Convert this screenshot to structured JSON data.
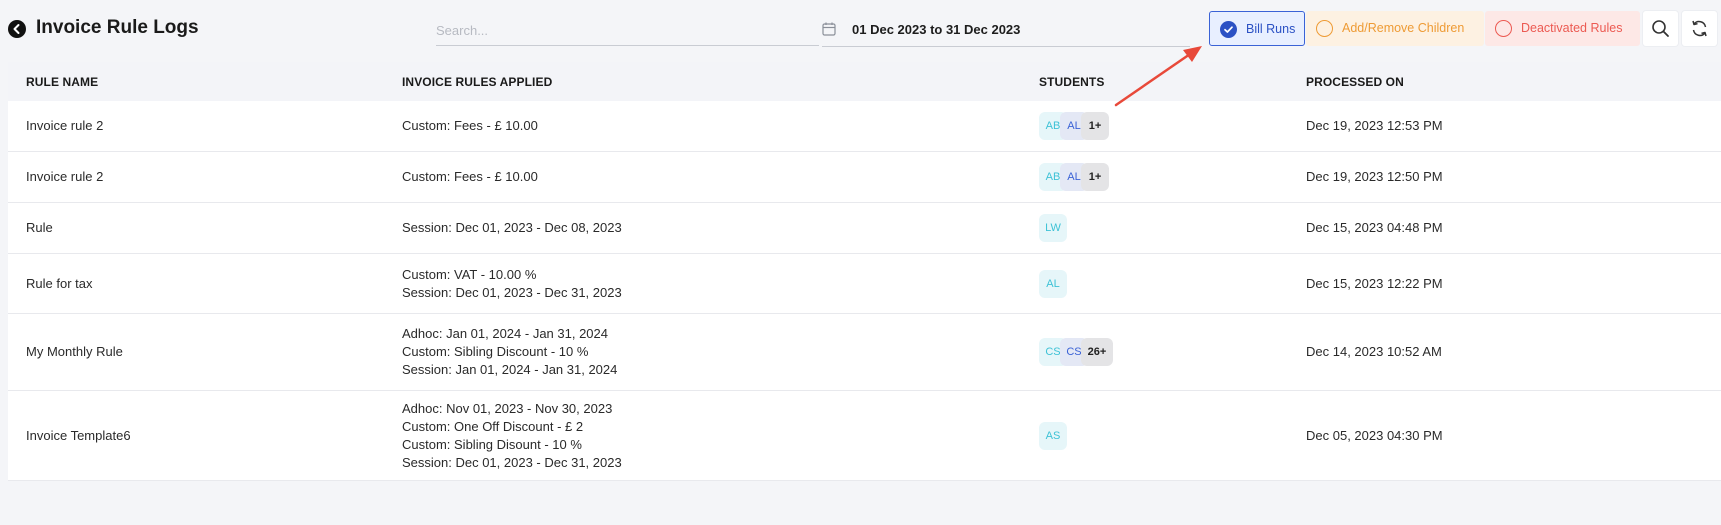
{
  "header": {
    "title": "Invoice Rule Logs",
    "search_placeholder": "Search...",
    "date_range": "01 Dec 2023 to 31 Dec 2023"
  },
  "filters": {
    "bill_runs": "Bill Runs",
    "add_remove_children": "Add/Remove Children",
    "deactivated_rules": "Deactivated Rules"
  },
  "colors": {
    "accent_blue": "#2b51c4",
    "accent_orange": "#ee9b35",
    "accent_red": "#ec5a52",
    "annotation_arrow": "#e8493a"
  },
  "table": {
    "columns": [
      "RULE NAME",
      "INVOICE RULES APPLIED",
      "STUDENTS",
      "PROCESSED ON"
    ],
    "rows": [
      {
        "name": "Invoice rule 2",
        "rules": [
          "Custom: Fees - £ 10.00"
        ],
        "students": [
          "AB",
          "AL"
        ],
        "more": "1+",
        "processed": "Dec 19, 2023 12:53 PM"
      },
      {
        "name": "Invoice rule 2",
        "rules": [
          "Custom: Fees - £ 10.00"
        ],
        "students": [
          "AB",
          "AL"
        ],
        "more": "1+",
        "processed": "Dec 19, 2023 12:50 PM"
      },
      {
        "name": "Rule",
        "rules": [
          "Session: Dec 01, 2023 - Dec 08, 2023"
        ],
        "students": [
          "LW"
        ],
        "more": "",
        "processed": "Dec 15, 2023 04:48 PM"
      },
      {
        "name": "Rule for tax",
        "rules": [
          "Custom: VAT - 10.00 %",
          "Session: Dec 01, 2023 - Dec 31, 2023"
        ],
        "students": [
          "AL"
        ],
        "more": "",
        "processed": "Dec 15, 2023 12:22 PM"
      },
      {
        "name": "My Monthly Rule",
        "rules": [
          "Adhoc: Jan 01, 2024 - Jan 31, 2024",
          "Custom: Sibling Discount - 10 %",
          "Session: Jan 01, 2024 - Jan 31, 2024"
        ],
        "students": [
          "CS",
          "CS"
        ],
        "more": "26+",
        "processed": "Dec 14, 2023 10:52 AM"
      },
      {
        "name": "Invoice Template6",
        "rules": [
          "Adhoc: Nov 01, 2023 - Nov 30, 2023",
          "Custom: One Off Discount - £ 2",
          "Custom: Sibling Disount - 10 %",
          "Session: Dec 01, 2023 - Dec 31, 2023"
        ],
        "students": [
          "AS"
        ],
        "more": "",
        "processed": "Dec 05, 2023 04:30 PM"
      }
    ]
  }
}
